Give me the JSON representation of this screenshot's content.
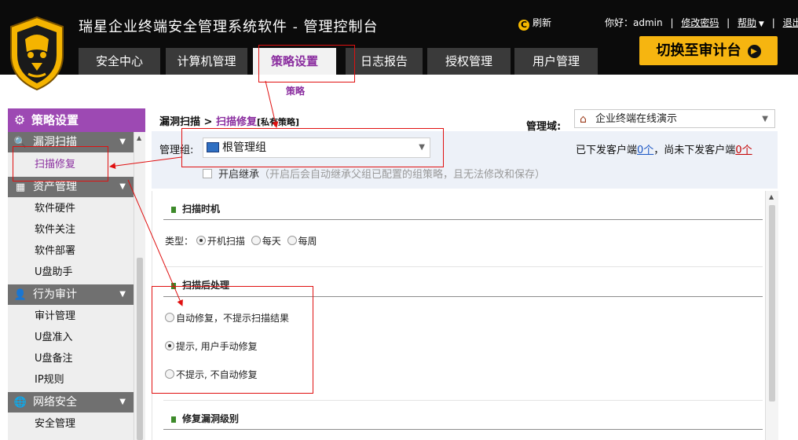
{
  "header": {
    "app_title": "瑞星企业终端安全管理系统软件 - 管理控制台",
    "refresh_label": "刷新",
    "greeting_prefix": "你好：",
    "username": "admin",
    "change_password": "修改密码",
    "help": "帮助",
    "logout": "退出",
    "switch_button": "切换至审计台"
  },
  "tabs": [
    {
      "label": "安全中心"
    },
    {
      "label": "计算机管理"
    },
    {
      "label": "策略设置",
      "active": true
    },
    {
      "label": "日志报告"
    },
    {
      "label": "授权管理"
    },
    {
      "label": "用户管理"
    }
  ],
  "tab_caption": "策略",
  "sidebar": {
    "title": "策略设置",
    "groups": [
      {
        "label": "漏洞扫描",
        "items": [
          "扫描修复"
        ]
      },
      {
        "label": "资产管理",
        "items": [
          "软件硬件",
          "软件关注",
          "软件部署",
          "U盘助手"
        ]
      },
      {
        "label": "行为审计",
        "items": [
          "审计管理",
          "U盘准入",
          "U盘备注",
          "IP规则"
        ]
      },
      {
        "label": "网络安全",
        "items": [
          "安全管理"
        ]
      }
    ],
    "active_item": "扫描修复"
  },
  "main": {
    "breadcrumb_parent": "漏洞扫描",
    "breadcrumb_sep": ">",
    "breadcrumb_current": "扫描修复",
    "breadcrumb_tag": "[私有策略]",
    "domain_label": "管理域:",
    "domain_value": "企业终端在线演示",
    "group_label": "管理组:",
    "group_value": "根管理组",
    "issued_prefix": "已下发客户端",
    "issued_count": "0个",
    "issued_mid": "，尚未下发客户端",
    "not_issued_count": "0个",
    "inherit_label": "开启继承",
    "inherit_hint": "（开启后会自动继承父组已配置的组策略，且无法修改和保存）"
  },
  "scan_timing": {
    "title": "扫描时机",
    "type_label": "类型：",
    "options": [
      "开机扫描",
      "每天",
      "每周"
    ],
    "selected_index": 0
  },
  "post_scan": {
    "title": "扫描后处理",
    "options": [
      "自动修复，不提示扫描结果",
      "提示, 用户手动修复",
      "不提示, 不自动修复"
    ],
    "selected_index": 1
  },
  "repair_level": {
    "title": "修复漏洞级别"
  },
  "colors": {
    "accent_purple": "#9d49b3",
    "switch_yellow": "#f6b510",
    "annotation_red": "#e01010"
  }
}
